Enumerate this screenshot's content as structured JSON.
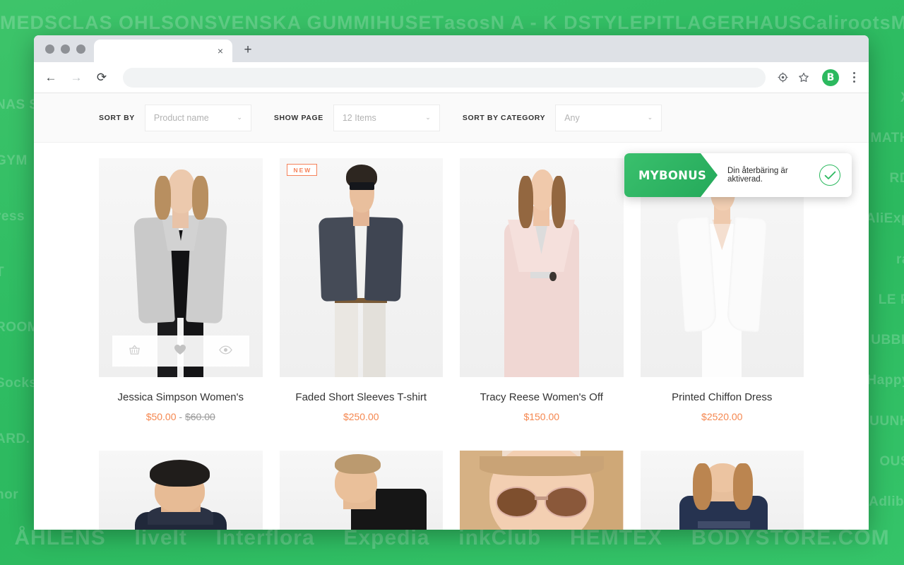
{
  "background": {
    "brand_logos_top": [
      "MEDS",
      "CLAS OHLSON",
      "SVENSKA GUMMIHUSET",
      "asos",
      "N A - K D",
      "STYLEPIT",
      "LAGERHAUS",
      "Caliroots",
      "MISTER SPEX"
    ],
    "brand_logos_bottom": [
      "ÅHLENS",
      "liveIt",
      "Interflora",
      "Expedia",
      "inkClub",
      "HEMTEX",
      "BODYSTORE.COM"
    ],
    "brand_logos_left": [
      "NAS SSE",
      "GYM",
      "ress",
      "T",
      "ROOM",
      "Socks",
      "ARD.",
      "nor"
    ],
    "brand_logos_right": [
      "X",
      "LI MATH",
      "RD",
      "AliExp",
      "ra",
      "LE P",
      "UBBL",
      "Happy",
      "UUNK",
      "OUS",
      "Adlibr"
    ],
    "accent_green": "#2cb95f"
  },
  "browser": {
    "tab": {
      "title": "",
      "close_label": "×"
    },
    "new_tab_label": "+",
    "nav": {
      "back": "←",
      "forward": "→",
      "reload": "⟳"
    },
    "omnibox": {
      "value": "",
      "placeholder": ""
    },
    "extension_badge": "B",
    "toolbar_icons": [
      "target-icon",
      "star-icon",
      "mybonus-extension-icon",
      "kebab-menu-icon"
    ]
  },
  "filters": [
    {
      "label": "SORT BY",
      "value": "Product name",
      "name": "sort-by"
    },
    {
      "label": "SHOW PAGE",
      "value": "12 Items",
      "name": "show-page"
    },
    {
      "label": "SORT BY CATEGORY",
      "value": "Any",
      "name": "sort-by-category"
    }
  ],
  "caret": "⌄",
  "hover_actions": [
    {
      "name": "add-to-cart-icon",
      "glyph": "☒"
    },
    {
      "name": "wishlist-heart-icon",
      "glyph": "♥"
    },
    {
      "name": "quick-view-eye-icon",
      "glyph": "◉"
    }
  ],
  "products_row1": [
    {
      "title": "Jessica Simpson Women's",
      "price": "$50.00",
      "price_separator": "-",
      "price_old": "$60.00",
      "badge": "",
      "has_hover_bar": true
    },
    {
      "title": "Faded Short Sleeves T-shirt",
      "price": "$250.00",
      "price_separator": "",
      "price_old": "",
      "badge": "NEW",
      "has_hover_bar": false
    },
    {
      "title": "Tracy Reese Women's Off",
      "price": "$150.00",
      "price_separator": "",
      "price_old": "",
      "badge": "",
      "has_hover_bar": false
    },
    {
      "title": "Printed Chiffon Dress",
      "price": "$2520.00",
      "price_separator": "",
      "price_old": "",
      "badge": "",
      "has_hover_bar": false
    }
  ],
  "products_row2": [
    {
      "title": "",
      "price": "",
      "badge": ""
    },
    {
      "title": "",
      "price": "",
      "badge": ""
    },
    {
      "title": "",
      "price": "",
      "badge": ""
    },
    {
      "title": "",
      "price": "",
      "badge": ""
    }
  ],
  "toast": {
    "brand": "MYBONUS",
    "message": "Din återbäring är aktiverad.",
    "status_icon": "check-circle-icon",
    "brand_color": "#2cb95f"
  }
}
